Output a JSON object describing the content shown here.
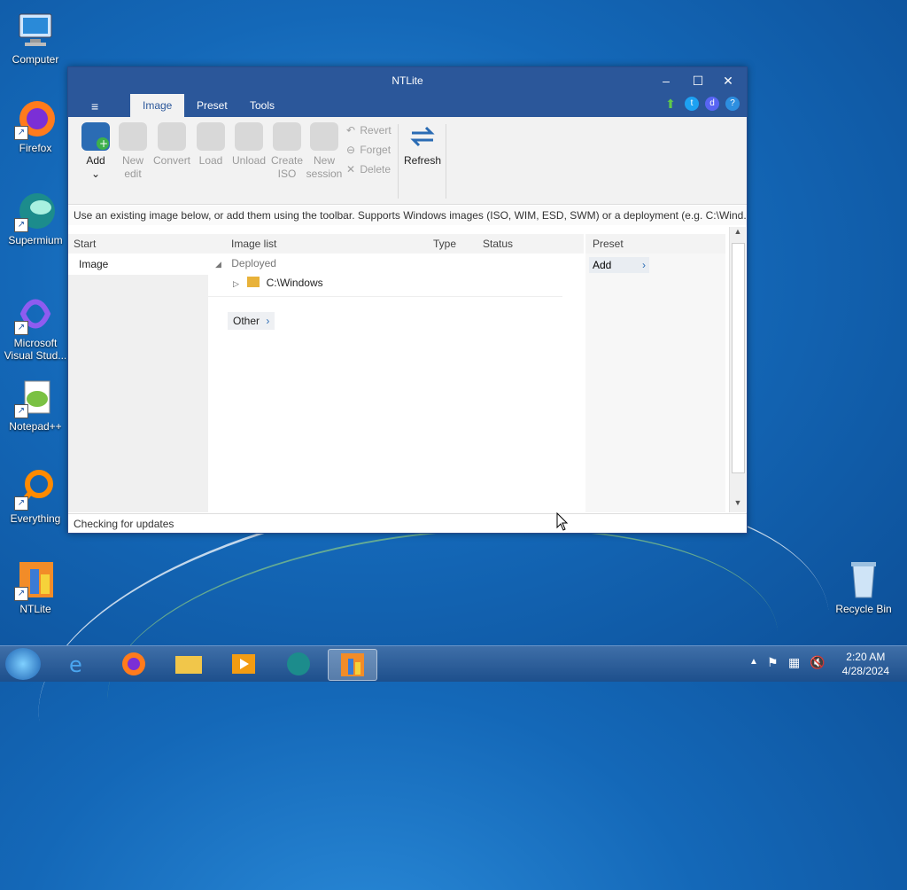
{
  "desktop": {
    "icons": [
      {
        "label": "Computer"
      },
      {
        "label": "Firefox"
      },
      {
        "label": "Supermium"
      },
      {
        "label": "Microsoft Visual Stud..."
      },
      {
        "label": "Notepad++"
      },
      {
        "label": "Everything"
      },
      {
        "label": "NTLite"
      },
      {
        "label": "Recycle Bin"
      }
    ]
  },
  "window": {
    "title": "NTLite",
    "menu_icon": "≡",
    "tabs": [
      "Image",
      "Preset",
      "Tools"
    ],
    "ribbon": {
      "add": "Add",
      "new_edit": "New\nedit",
      "convert": "Convert",
      "load": "Load",
      "unload": "Unload",
      "create_iso": "Create\nISO",
      "new_session": "New\nsession",
      "revert": "Revert",
      "forget": "Forget",
      "delete": "Delete",
      "refresh": "Refresh"
    },
    "hint": "Use an existing image below, or add them using the toolbar. Supports Windows images (ISO, WIM, ESD, SWM) or a deployment (e.g. C:\\Wind...",
    "left": {
      "header": "Start",
      "item": "Image"
    },
    "list": {
      "headers": [
        "Image list",
        "Type",
        "Status"
      ],
      "group": "Deployed",
      "entry": "C:\\Windows",
      "other": "Other"
    },
    "preset": {
      "header": "Preset",
      "add": "Add"
    },
    "status": "Checking for updates"
  },
  "taskbar": {
    "time": "2:20 AM",
    "date": "4/28/2024"
  }
}
